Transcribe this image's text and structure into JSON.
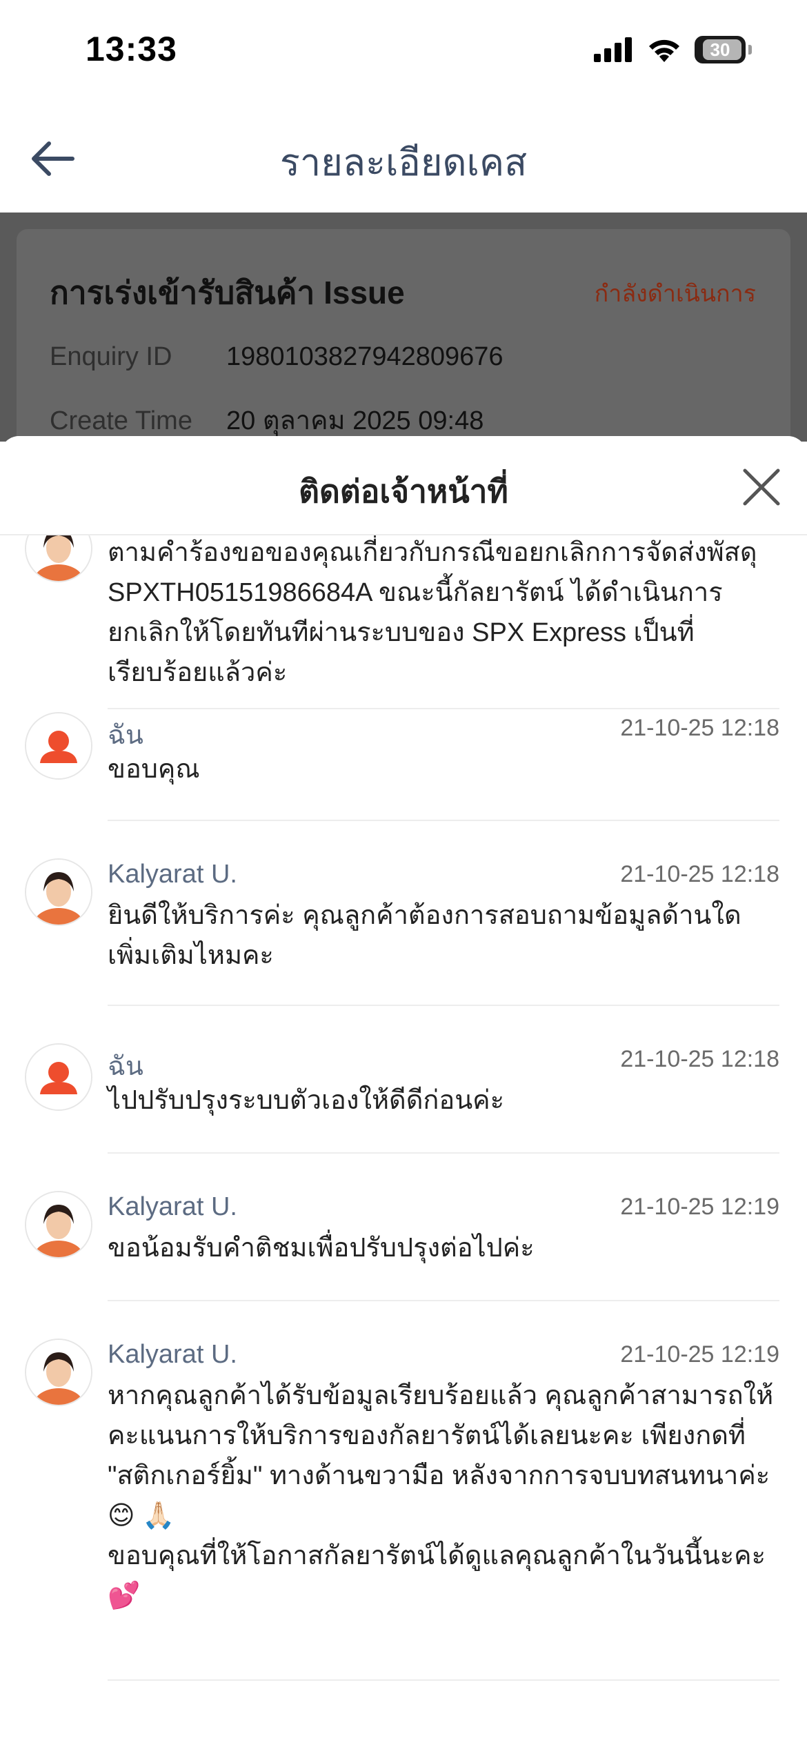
{
  "status_bar": {
    "time": "13:33",
    "battery": "30"
  },
  "nav": {
    "title": "รายละเอียดเคส"
  },
  "case": {
    "title": "การเร่งเข้ารับสินค้า Issue",
    "status": "กำลังดำเนินการ",
    "enquiry_label": "Enquiry ID",
    "enquiry_value": "1980103827942809676",
    "create_label": "Create Time",
    "create_value": "20 ตุลาคม 2025 09:48"
  },
  "sheet": {
    "title": "ติดต่อเจ้าหน้าที่"
  },
  "messages": [
    {
      "text": "ตามคำร้องขอของคุณเกี่ยวกับกรณีขอยกเลิกการจัดส่งพัสดุ SPXTH05151986684A ขณะนี้กัลยารัตน์ ได้ดำเนินการยกเลิกให้โดยทันทีผ่านระบบของ SPX Express เป็นที่เรียบร้อยแล้วค่ะ"
    },
    {
      "name": "ฉัน",
      "time": "21-10-25 12:18",
      "text": "ขอบคุณ"
    },
    {
      "name": "Kalyarat U.",
      "time": "21-10-25 12:18",
      "text": "ยินดีให้บริการค่ะ คุณลูกค้าต้องการสอบถามข้อมูลด้านใดเพิ่มเติมไหมคะ"
    },
    {
      "name": "ฉัน",
      "time": "21-10-25 12:18",
      "text": "ไปปรับปรุงระบบตัวเองให้ดีดีก่อนค่ะ"
    },
    {
      "name": "Kalyarat U.",
      "time": "21-10-25 12:19",
      "text": "ขอน้อมรับคำติชมเพื่อปรับปรุงต่อไปค่ะ"
    },
    {
      "name": "Kalyarat U.",
      "time": "21-10-25 12:19",
      "text": "หากคุณลูกค้าได้รับข้อมูลเรียบร้อยแล้ว คุณลูกค้าสามารถให้คะแนนการให้บริการของกัลยารัตน์ได้เลยนะคะ เพียงกดที่ \"สติกเกอร์ยิ้ม\" ทางด้านขวามือ หลังจากการจบบทสนทนาค่ะ 😊 🙏🏻\nขอบคุณที่ให้โอกาสกัลยารัตน์ได้ดูแลคุณลูกค้าในวันนี้นะคะ 💕"
    }
  ]
}
